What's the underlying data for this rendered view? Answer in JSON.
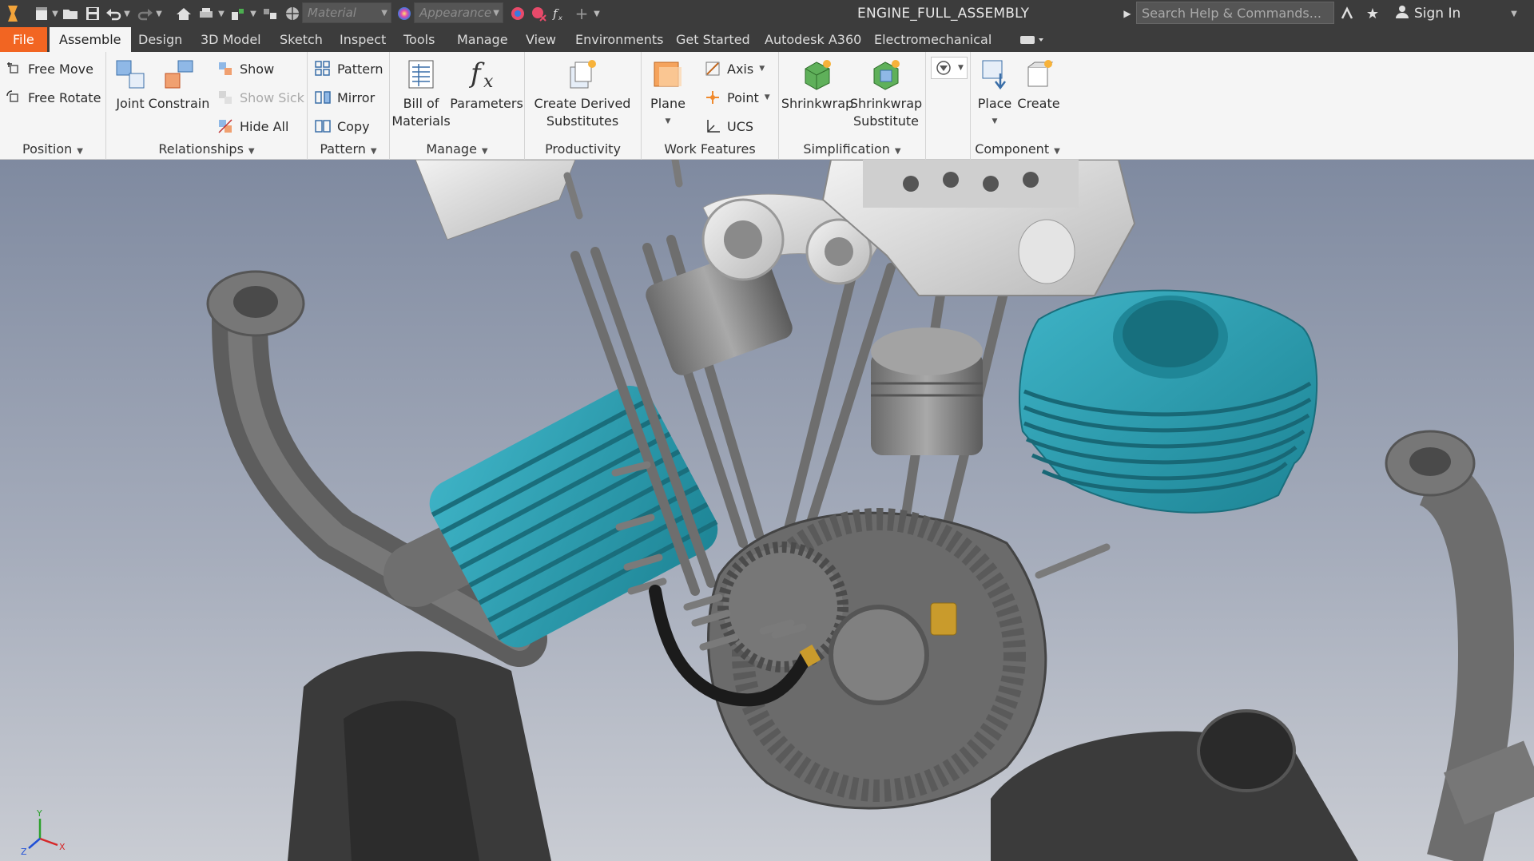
{
  "app": {
    "document_title": "ENGINE_FULL_ASSEMBLY"
  },
  "quick_access": {
    "material_placeholder": "Material",
    "appearance_placeholder": "Appearance",
    "search_placeholder": "Search Help & Commands...",
    "sign_in": "Sign In"
  },
  "tabs": [
    {
      "label": "File"
    },
    {
      "label": "Assemble"
    },
    {
      "label": "Design"
    },
    {
      "label": "3D Model"
    },
    {
      "label": "Sketch"
    },
    {
      "label": "Inspect"
    },
    {
      "label": "Tools"
    },
    {
      "label": "Manage"
    },
    {
      "label": "View"
    },
    {
      "label": "Environments"
    },
    {
      "label": "Get Started"
    },
    {
      "label": "Autodesk A360"
    },
    {
      "label": "Electromechanical"
    }
  ],
  "ribbon": {
    "position": {
      "title": "Position",
      "free_move": "Free Move",
      "free_rotate": "Free Rotate"
    },
    "relationships": {
      "title": "Relationships",
      "joint": "Joint",
      "constrain": "Constrain",
      "show": "Show",
      "show_sick": "Show Sick",
      "hide_all": "Hide All"
    },
    "pattern": {
      "title": "Pattern",
      "pattern": "Pattern",
      "mirror": "Mirror",
      "copy": "Copy"
    },
    "manage": {
      "title": "Manage",
      "bom_1": "Bill of",
      "bom_2": "Materials",
      "parameters": "Parameters"
    },
    "productivity": {
      "title": "Productivity",
      "cds_1": "Create Derived",
      "cds_2": "Substitutes"
    },
    "work_features": {
      "title": "Work Features",
      "plane": "Plane",
      "axis": "Axis",
      "point": "Point",
      "ucs": "UCS"
    },
    "simplification": {
      "title": "Simplification",
      "shrinkwrap": "Shrinkwrap",
      "sws_1": "Shrinkwrap",
      "sws_2": "Substitute"
    },
    "component": {
      "title": "Component",
      "place": "Place",
      "create": "Create"
    }
  },
  "colors": {
    "file_tab": "#f26522",
    "cylinder_teal": "#2a9db0",
    "titlebar": "#3c3c3c",
    "ribbon": "#f5f5f5"
  },
  "viewport": {
    "content": "exploded engine assembly 3D model",
    "triad_axes": [
      "X",
      "Y",
      "Z"
    ]
  }
}
